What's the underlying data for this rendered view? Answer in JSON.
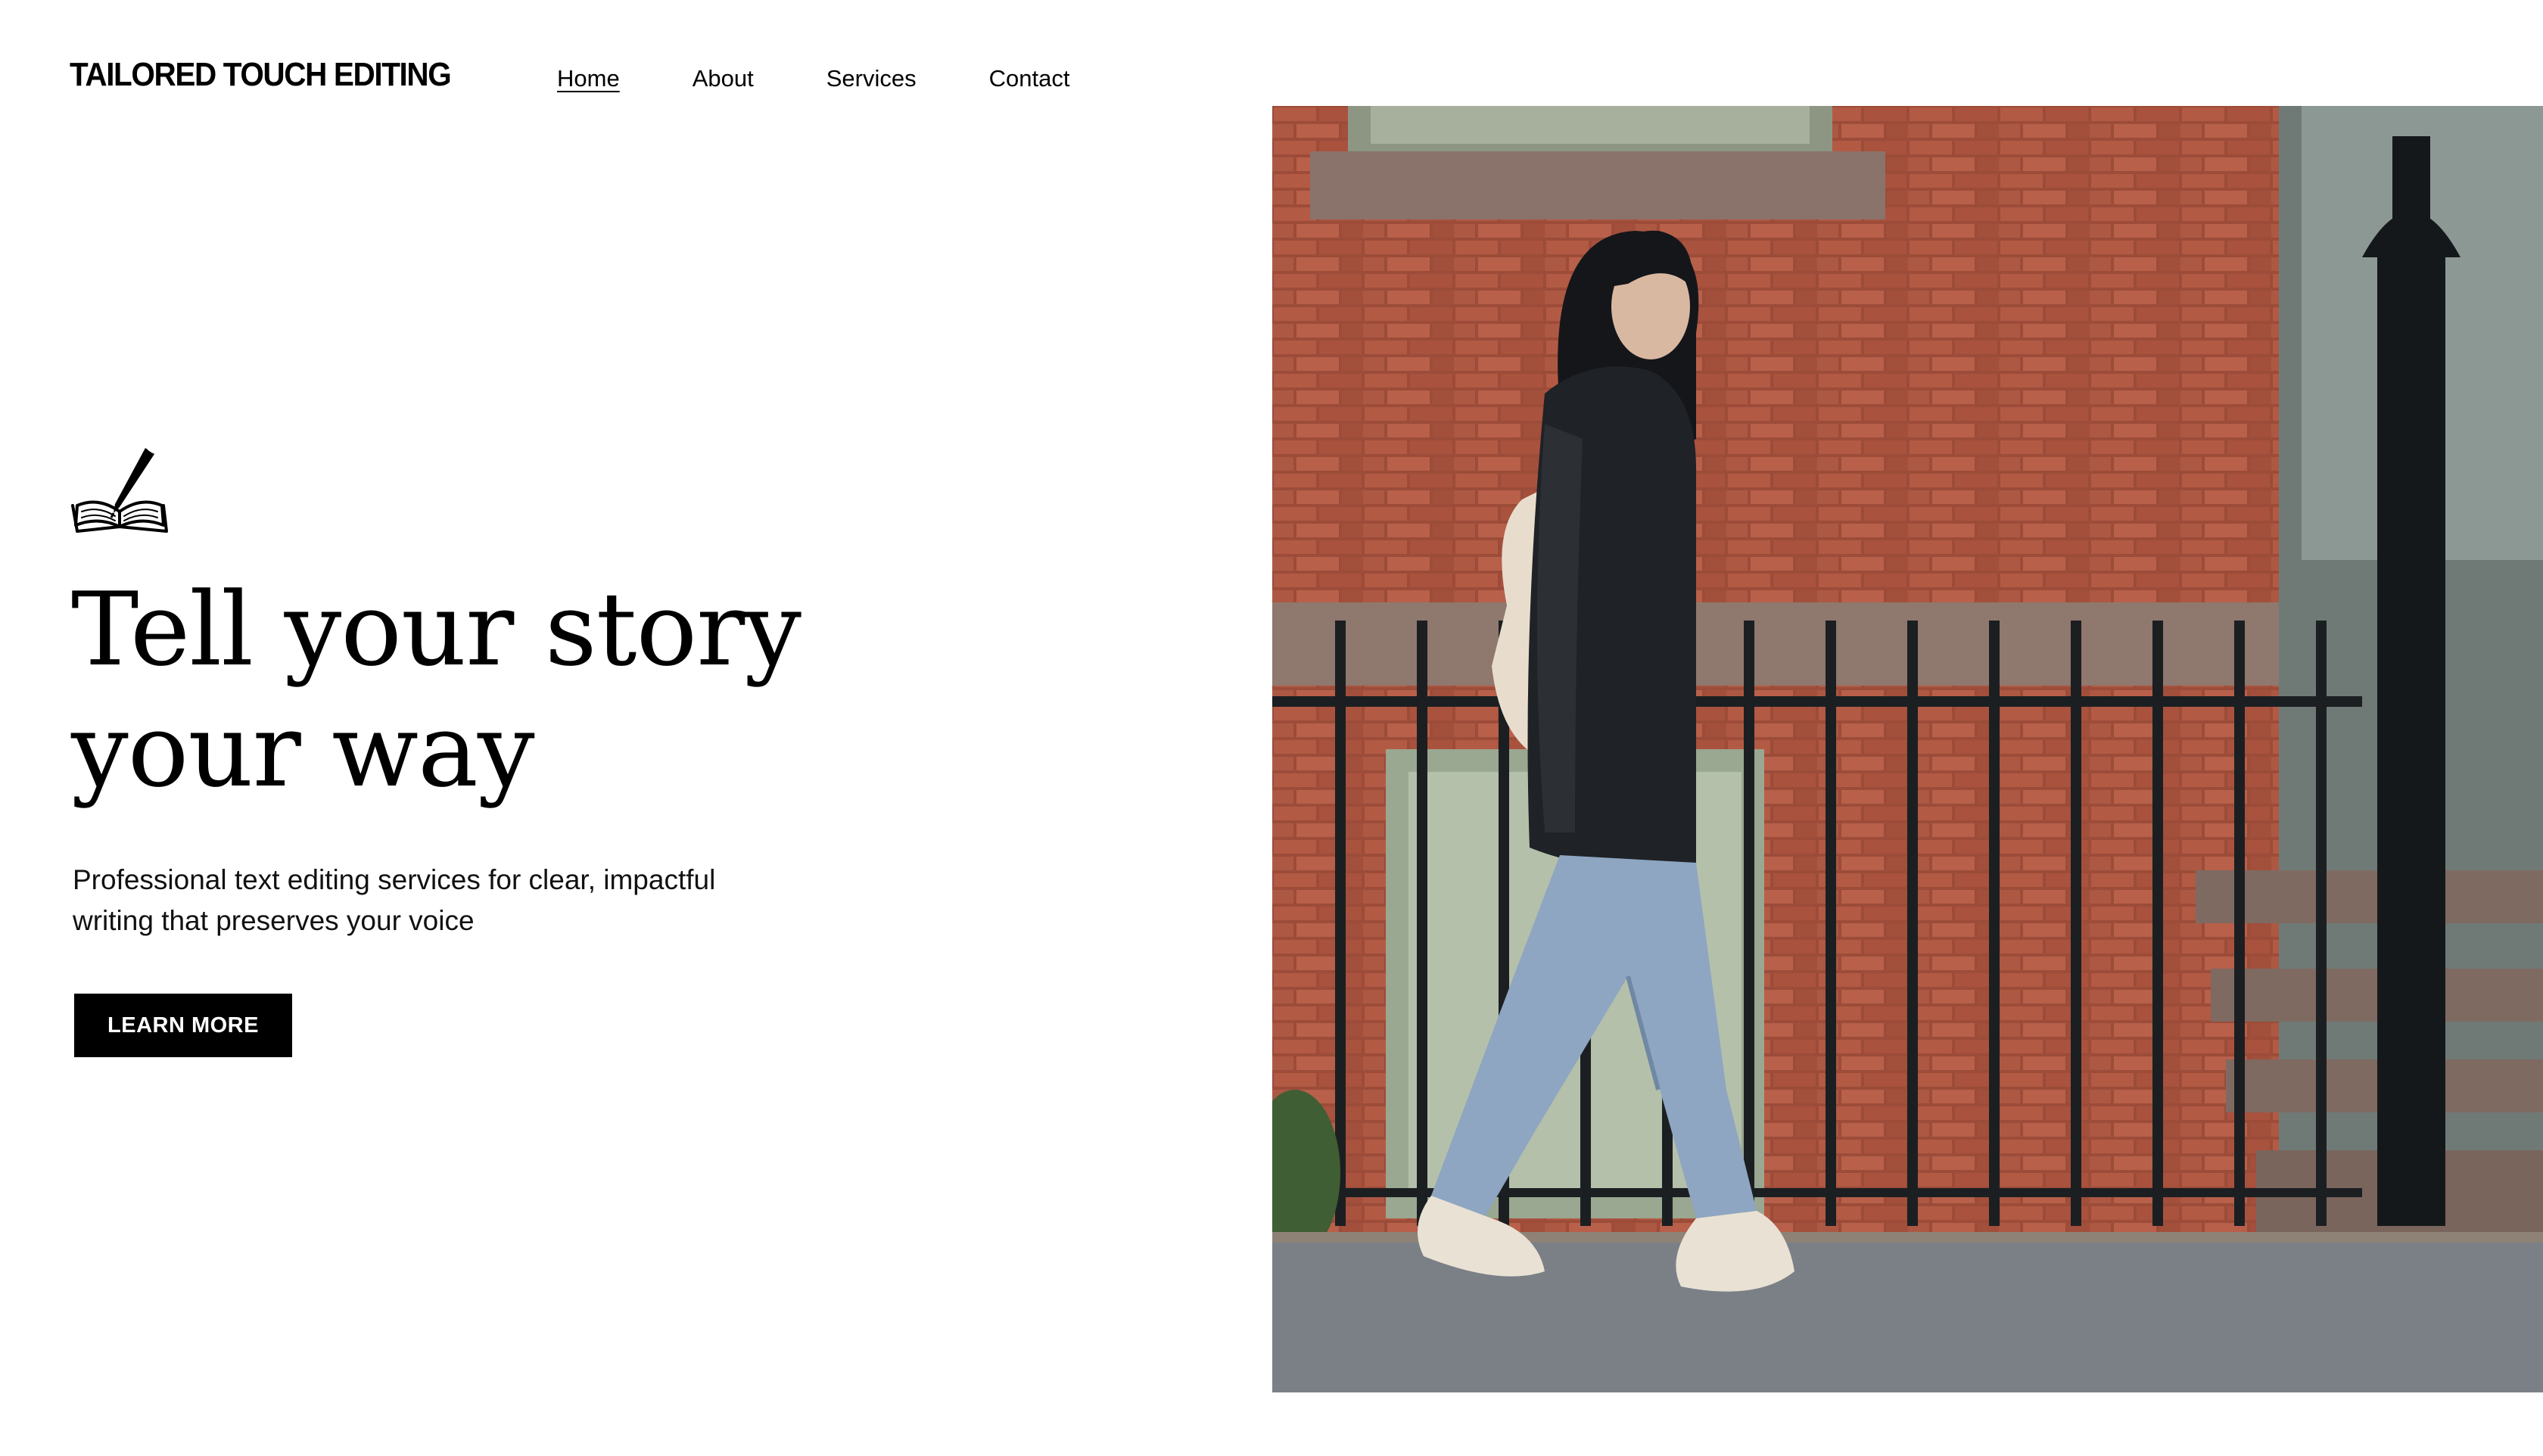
{
  "brand": {
    "logo_text": "TAILORED TOUCH EDITING"
  },
  "nav": {
    "items": [
      {
        "label": "Home",
        "active": true
      },
      {
        "label": "About",
        "active": false
      },
      {
        "label": "Services",
        "active": false
      },
      {
        "label": "Contact",
        "active": false
      }
    ]
  },
  "hero": {
    "icon": "book-pen-icon",
    "headline_line1": "Tell your story",
    "headline_line2": "your way",
    "subtext_line1": "Professional text editing services for clear, impactful",
    "subtext_line2": "writing that preserves your voice",
    "cta_label": "LEARN MORE",
    "photo_icon": "woman-walking-photo"
  },
  "colors": {
    "background": "#ffffff",
    "text": "#000000",
    "button_bg": "#000000",
    "button_text": "#ffffff",
    "brick": "#a8543f",
    "sidewalk": "#7b8087"
  }
}
